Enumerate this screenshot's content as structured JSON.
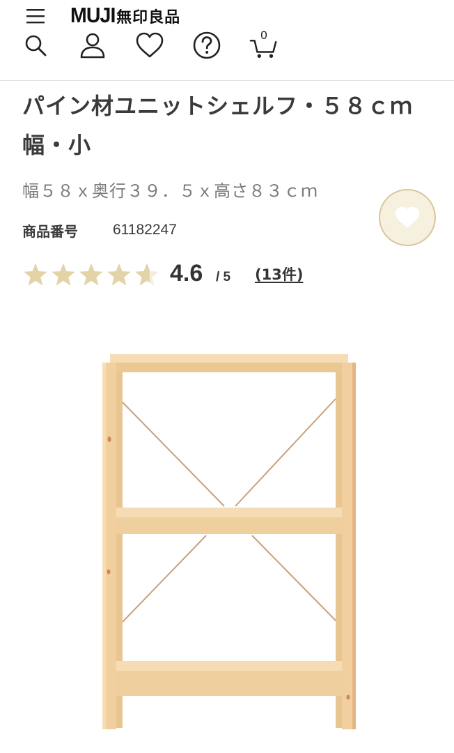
{
  "header": {
    "logo_en": "MUJI",
    "logo_jp": "無印良品",
    "cart_count": "0",
    "icons": [
      "menu-icon",
      "search-icon",
      "user-icon",
      "heart-icon",
      "help-icon",
      "cart-icon"
    ]
  },
  "product": {
    "title": "パイン材ユニットシェルフ・５８ｃｍ幅・小",
    "spec": "幅５８ｘ奥行３９．５ｘ高さ８３ｃｍ",
    "code_label": "商品番号",
    "code_value": "61182247",
    "favorite_icon": "heart-icon"
  },
  "rating": {
    "value": "4.6",
    "max": "/ 5",
    "count": "(13件)",
    "stars_filled": 4.6,
    "stars_total": 5
  },
  "colors": {
    "star": "#e3d3a8",
    "wood": "#f0cfa0",
    "fav_bg": "#f6f0df",
    "fav_border": "#d8c69c"
  }
}
